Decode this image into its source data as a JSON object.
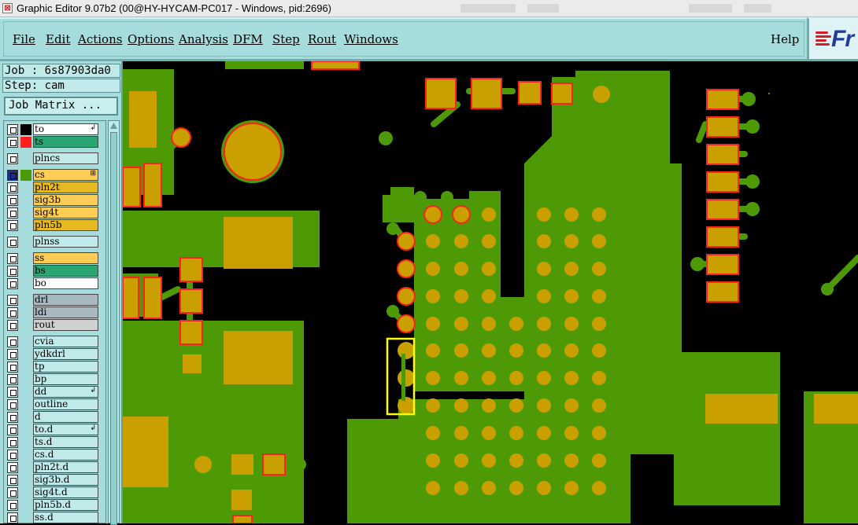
{
  "window": {
    "title": "Graphic Editor 9.07b2 (00@HY-HYCAM-PC017 - Windows, pid:2696)"
  },
  "menu": {
    "items": [
      {
        "label": "File"
      },
      {
        "label": "Edit"
      },
      {
        "label": "Actions"
      },
      {
        "label": "Options"
      },
      {
        "label": "Analysis"
      },
      {
        "label": "DFM"
      },
      {
        "label": "Step"
      },
      {
        "label": "Rout"
      },
      {
        "label": "Windows"
      }
    ],
    "help": "Help"
  },
  "logo": {
    "text": "Fr"
  },
  "info": {
    "job": "Job : 6s87903da0",
    "step": "Step: cam",
    "job_matrix": "Job Matrix ..."
  },
  "colors": {
    "copper": "#4e9a06",
    "pad": "#c9a000",
    "highlight": "#ff2020",
    "selection": "#ffff00",
    "panel": "#a6dcdc"
  },
  "layers": [
    {
      "name": "to",
      "bg": "#ffffff",
      "swatch": "#000000",
      "mark": "↲"
    },
    {
      "name": "ts",
      "bg": "#2aa673",
      "swatch": "#ff1f1f"
    },
    {
      "name": "plncs",
      "bg": "#c0eaea",
      "swatch": ""
    },
    {
      "name": "cs",
      "bg": "#ffcc55",
      "swatch": "#4e9a06",
      "active": true,
      "mark": "⊞"
    },
    {
      "name": "pln2t",
      "bg": "#e6b822",
      "swatch": ""
    },
    {
      "name": "sig3b",
      "bg": "#ffcc55",
      "swatch": ""
    },
    {
      "name": "sig4t",
      "bg": "#ffcc55",
      "swatch": ""
    },
    {
      "name": "pln5b",
      "bg": "#e6b822",
      "swatch": ""
    },
    {
      "name": "plnss",
      "bg": "#c0eaea",
      "swatch": ""
    },
    {
      "name": "ss",
      "bg": "#ffcc55",
      "swatch": ""
    },
    {
      "name": "bs",
      "bg": "#2aa673",
      "swatch": ""
    },
    {
      "name": "bo",
      "bg": "#ffffff",
      "swatch": ""
    },
    {
      "name": "drl",
      "bg": "#a8b8c0",
      "swatch": ""
    },
    {
      "name": "ldi",
      "bg": "#a8b8c0",
      "swatch": ""
    },
    {
      "name": "rout",
      "bg": "#d0d0d0",
      "swatch": ""
    },
    {
      "name": "cvia",
      "bg": "#c0eaea",
      "swatch": ""
    },
    {
      "name": "ydkdrl",
      "bg": "#c0eaea",
      "swatch": ""
    },
    {
      "name": "tp",
      "bg": "#c0eaea",
      "swatch": ""
    },
    {
      "name": "bp",
      "bg": "#c0eaea",
      "swatch": ""
    },
    {
      "name": "dd",
      "bg": "#c0eaea",
      "swatch": "",
      "mark": "↲"
    },
    {
      "name": "outline",
      "bg": "#c0eaea",
      "swatch": ""
    },
    {
      "name": "d",
      "bg": "#c0eaea",
      "swatch": ""
    },
    {
      "name": "to.d",
      "bg": "#c0eaea",
      "swatch": "",
      "mark": "↲"
    },
    {
      "name": "ts.d",
      "bg": "#c0eaea",
      "swatch": ""
    },
    {
      "name": "cs.d",
      "bg": "#c0eaea",
      "swatch": ""
    },
    {
      "name": "pln2t.d",
      "bg": "#c0eaea",
      "swatch": ""
    },
    {
      "name": "sig3b.d",
      "bg": "#c0eaea",
      "swatch": ""
    },
    {
      "name": "sig4t.d",
      "bg": "#c0eaea",
      "swatch": ""
    },
    {
      "name": "pln5b.d",
      "bg": "#c0eaea",
      "swatch": ""
    },
    {
      "name": "ss.d",
      "bg": "#c0eaea",
      "swatch": ""
    }
  ]
}
